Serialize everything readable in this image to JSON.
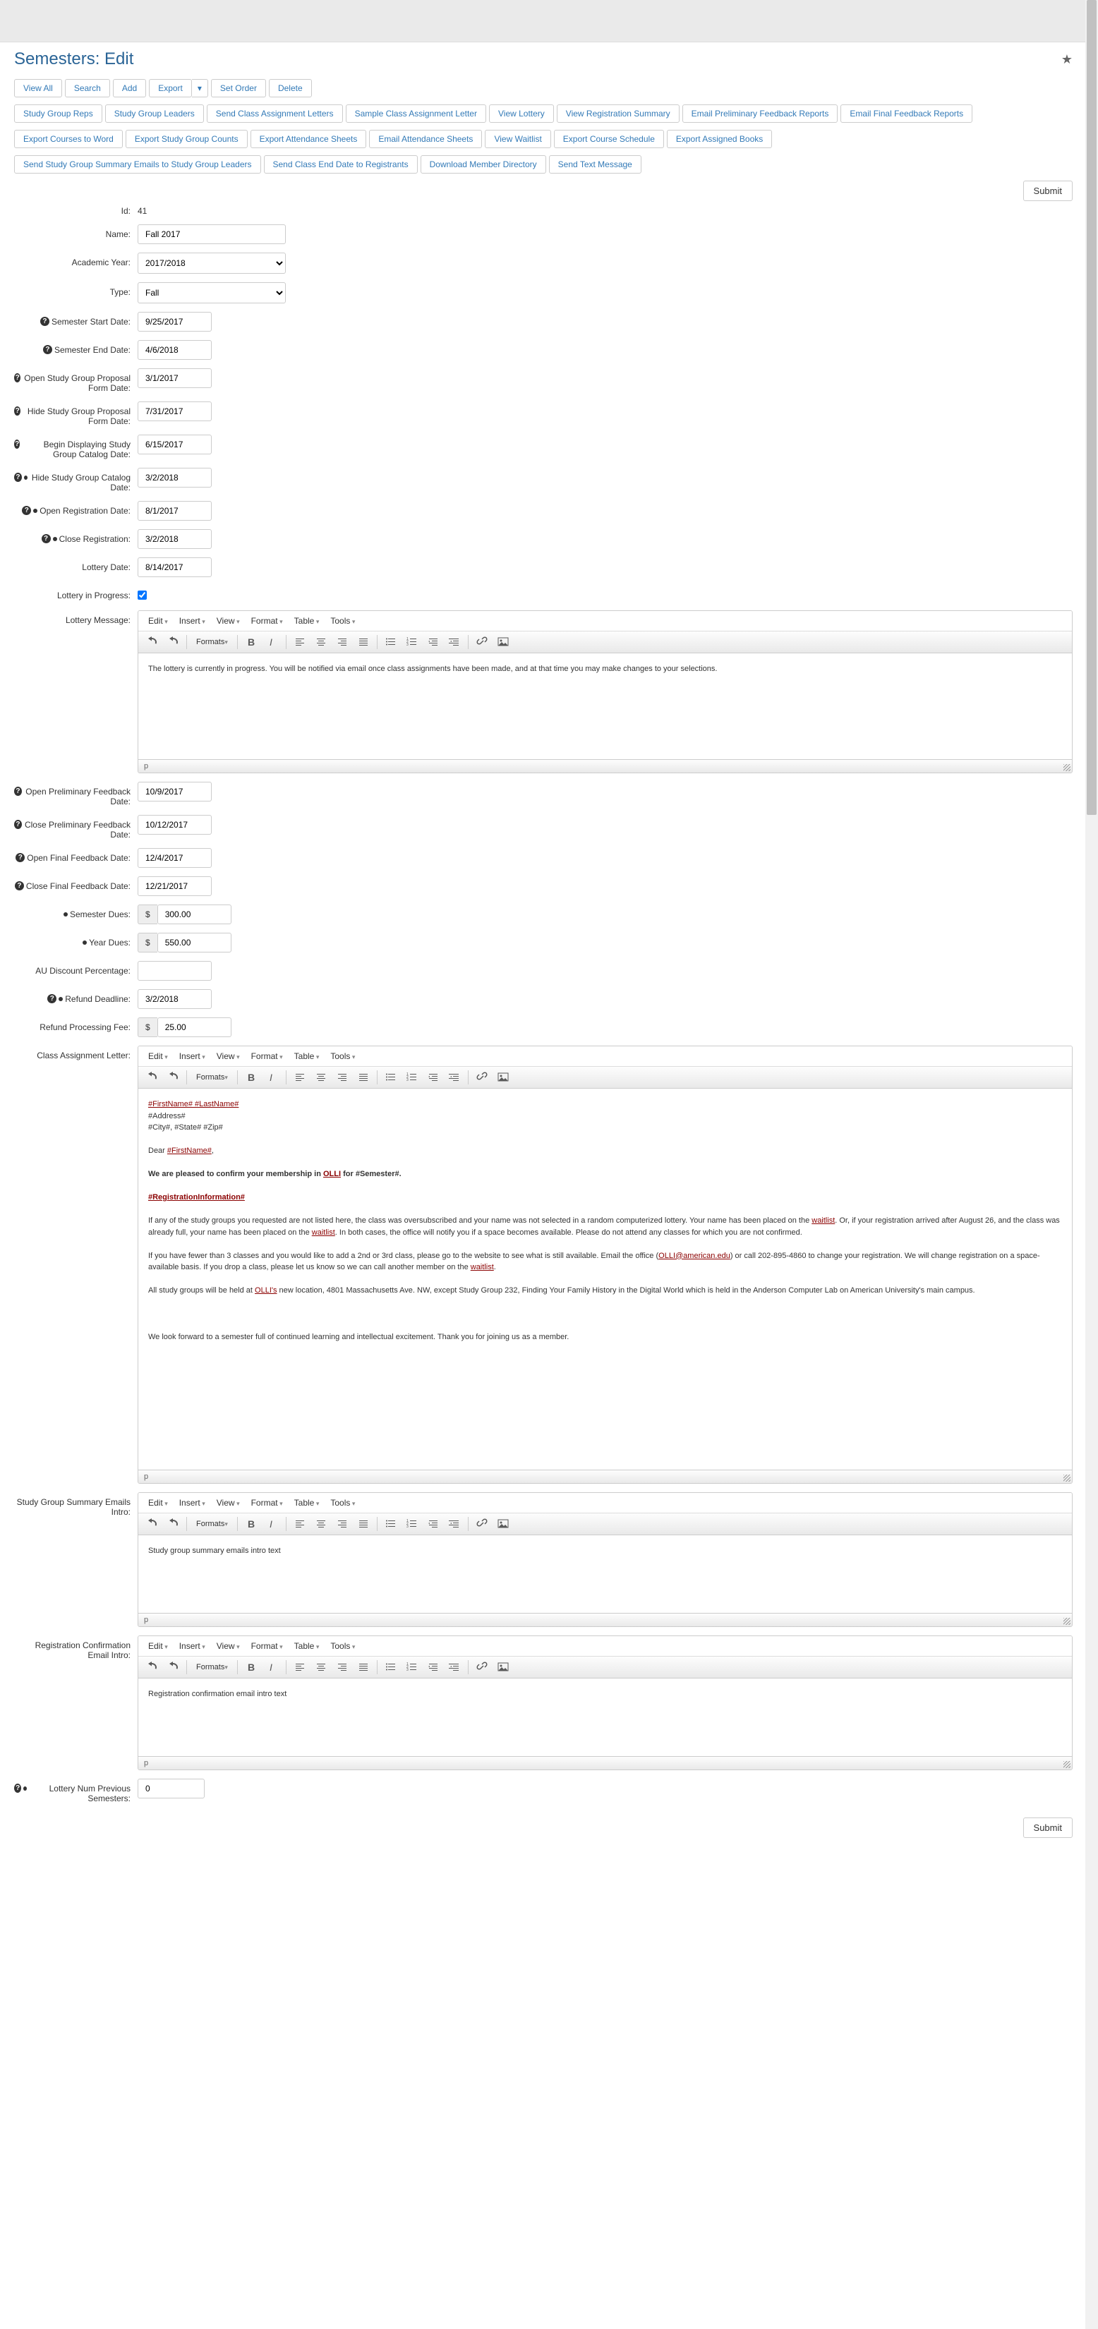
{
  "page": {
    "title": "Semesters: Edit",
    "star": "★",
    "submit": "Submit"
  },
  "nav": [
    [
      "View All",
      "Search",
      "Add",
      "Export",
      "▾",
      "Set Order",
      "Delete"
    ],
    [
      "Study Group Reps",
      "Study Group Leaders",
      "Send Class Assignment Letters",
      "Sample Class Assignment Letter",
      "View Lottery",
      "View Registration Summary",
      "Email Preliminary Feedback Reports",
      "Email Final Feedback Reports"
    ],
    [
      "Export Courses to Word",
      "Export Study Group Counts",
      "Export Attendance Sheets",
      "Email Attendance Sheets",
      "View Waitlist",
      "Export Course Schedule",
      "Export Assigned Books"
    ],
    [
      "Send Study Group Summary Emails to Study Group Leaders",
      "Send Class End Date to Registrants",
      "Download Member Directory",
      "Send Text Message"
    ]
  ],
  "fields": {
    "id": {
      "label": "Id:",
      "value": "41"
    },
    "name": {
      "label": "Name:",
      "value": "Fall 2017"
    },
    "academic_year": {
      "label": "Academic Year:",
      "value": "2017/2018"
    },
    "type": {
      "label": "Type:",
      "value": "Fall"
    },
    "sem_start": {
      "label": "Semester Start Date:",
      "value": "9/25/2017"
    },
    "sem_end": {
      "label": "Semester End Date:",
      "value": "4/6/2018"
    },
    "prop_open": {
      "label": "Open Study Group Proposal Form Date:",
      "value": "3/1/2017"
    },
    "prop_hide": {
      "label": "Hide Study Group Proposal Form Date:",
      "value": "7/31/2017"
    },
    "cat_begin": {
      "label": "Begin Displaying Study Group Catalog Date:",
      "value": "6/15/2017"
    },
    "cat_hide": {
      "label": "Hide Study Group Catalog Date:",
      "value": "3/2/2018"
    },
    "reg_open": {
      "label": "Open Registration Date:",
      "value": "8/1/2017"
    },
    "reg_close": {
      "label": "Close Registration:",
      "value": "3/2/2018"
    },
    "lottery_date": {
      "label": "Lottery Date:",
      "value": "8/14/2017"
    },
    "lottery_prog": {
      "label": "Lottery in Progress:"
    },
    "lottery_msg": {
      "label": "Lottery Message:"
    },
    "prelim_open": {
      "label": "Open Preliminary Feedback Date:",
      "value": "10/9/2017"
    },
    "prelim_close": {
      "label": "Close Preliminary Feedback Date:",
      "value": "10/12/2017"
    },
    "final_open": {
      "label": "Open Final Feedback Date:",
      "value": "12/4/2017"
    },
    "final_close": {
      "label": "Close Final Feedback Date:",
      "value": "12/21/2017"
    },
    "sem_dues": {
      "label": "Semester Dues:",
      "value": "300.00"
    },
    "year_dues": {
      "label": "Year Dues:",
      "value": "550.00"
    },
    "au_discount": {
      "label": "AU Discount Percentage:",
      "value": ""
    },
    "refund_deadline": {
      "label": "Refund Deadline:",
      "value": "3/2/2018"
    },
    "refund_fee": {
      "label": "Refund Processing Fee:",
      "value": "25.00"
    },
    "class_letter": {
      "label": "Class Assignment Letter:"
    },
    "sg_intro": {
      "label": "Study Group Summary Emails Intro:"
    },
    "reg_conf": {
      "label": "Registration Confirmation Email Intro:"
    },
    "lottery_num": {
      "label": "Lottery Num Previous Semesters:",
      "value": "0"
    }
  },
  "currency": "$",
  "editor_menu": [
    "Edit",
    "Insert",
    "View",
    "Format",
    "Table",
    "Tools"
  ],
  "editor_formats": "Formats",
  "status_p": "p",
  "content": {
    "lottery_msg": "The lottery is currently in progress. You will be notified via email once class assignments have been made, and at that time you may make changes to your selections.",
    "sg_intro": "Study group summary emails intro text",
    "reg_conf": "Registration confirmation email intro text",
    "letter": {
      "l1": "#FirstName# #LastName#",
      "l2": "#Address#",
      "l3": "#City#, #State# #Zip#",
      "l4a": "Dear ",
      "l4b": "#FirstName#",
      "l4c": ",",
      "l5a": "We are pleased to confirm your membership in ",
      "l5b": "OLLI",
      "l5c": " for #Semester#.",
      "l6": "#RegistrationInformation#",
      "l7a": "If any of the study groups you requested are not listed here, the class was oversubscribed and your name was not selected in a random computerized lottery. Your name has been placed on the ",
      "l7b": "waitlist",
      "l7c": ". Or, if your registration arrived after August 26, and the class was already full, your name has been placed on the ",
      "l7d": "waitlist",
      "l7e": ". In both cases, the office will notify you if a space becomes available. Please do not attend any classes for which you are not confirmed.",
      "l8a": "If you have fewer than 3 classes and you would like to add a 2nd or 3rd class, please go to the website to see what is still available. Email the office (",
      "l8b": "OLLI@american.edu",
      "l8c": ") or call 202-895-4860 to change your registration. We will change registration on a space-available basis.  If you drop a class, please let us know so we can call another member on the ",
      "l8d": "waitlist",
      "l8e": ".",
      "l9a": "All study groups will be held at ",
      "l9b": "OLLI's",
      "l9c": " new location, 4801 Massachusetts Ave. NW, except Study Group 232, Finding Your Family History in the Digital World which is held in the Anderson Computer Lab on American University's main campus.",
      "l10": "We look forward to a semester full of continued learning and intellectual excitement. Thank you for joining us as a member."
    }
  }
}
